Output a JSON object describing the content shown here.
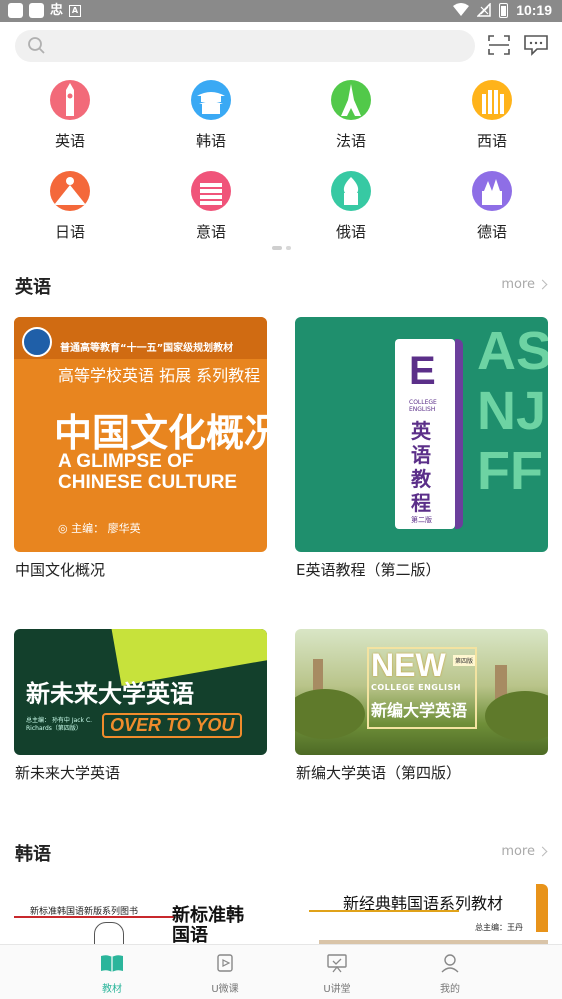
{
  "status_bar": {
    "time": "10:19",
    "left_glyph": "忠",
    "left_badge": "A"
  },
  "header": {
    "search_placeholder": "",
    "search_icon": "search-icon",
    "scan_icon": "scan-icon",
    "message_icon": "message-icon"
  },
  "languages": [
    {
      "label": "英语",
      "color": "#f26a79"
    },
    {
      "label": "韩语",
      "color": "#3aa9f4"
    },
    {
      "label": "法语",
      "color": "#52c94a"
    },
    {
      "label": "西语",
      "color": "#ffb31a"
    },
    {
      "label": "日语",
      "color": "#f4683a"
    },
    {
      "label": "意语",
      "color": "#f0547a"
    },
    {
      "label": "俄语",
      "color": "#37c9a3"
    },
    {
      "label": "德语",
      "color": "#8e6ee6"
    }
  ],
  "sections": [
    {
      "title": "英语",
      "more": "more",
      "books": [
        {
          "title": "中国文化概况",
          "cover": {
            "top_line": "普通高等教育“十一五”国家级规划教材",
            "series": "高等学校英语 拓展 系列教程",
            "big_title": "中国文化概况",
            "en_line1": "A GLIMPSE OF",
            "en_line2": "CHINESE CULTURE",
            "author": "◎ 主编：   廖华英"
          }
        },
        {
          "title": "E英语教程（第二版）",
          "cover": {
            "letter": "E",
            "sub": "COLLEGE ENGLISH",
            "vertical_title": "英语教程",
            "edition": "第二版",
            "bg_text": "ASNJFF"
          }
        },
        {
          "title": "新未来大学英语",
          "cover": {
            "big_title": "新未来大学英语",
            "over_to_you": "OVER TO YOU",
            "small": "总主编： 孙有中 Jack C. Richards（第四版）"
          }
        },
        {
          "title": "新编大学英语（第四版）",
          "cover": {
            "new": "NEW",
            "college_english": "COLLEGE ENGLISH",
            "cn_title": "新编大学英语",
            "edition_badge": "第四版"
          }
        }
      ]
    },
    {
      "title": "韩语",
      "more": "more",
      "books": [
        {
          "cover": {
            "series_line": "新标准韩国语新版系列图书",
            "big_title": "新标准韩国语"
          }
        },
        {
          "cover": {
            "series_line": "新经典韩国语系列教材",
            "author": "总主编：王丹"
          }
        }
      ]
    }
  ],
  "nav": [
    {
      "label": "教材",
      "icon": "book-icon",
      "active": true
    },
    {
      "label": "U微课",
      "icon": "video-icon",
      "active": false
    },
    {
      "label": "U讲堂",
      "icon": "lecture-icon",
      "active": false
    },
    {
      "label": "我的",
      "icon": "profile-icon",
      "active": false
    }
  ],
  "colors": {
    "accent": "#2bb59b",
    "status_bar": "#8a8a8a"
  }
}
